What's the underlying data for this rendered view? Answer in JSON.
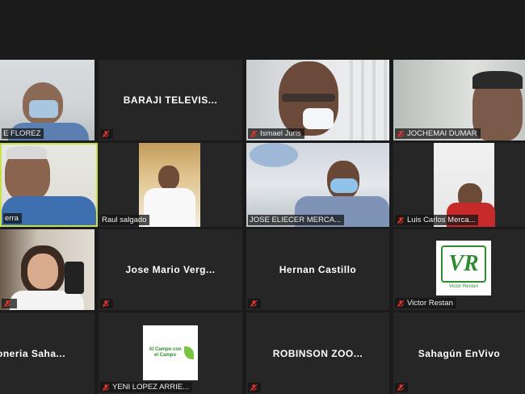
{
  "participants": [
    {
      "name": "E FLOREZ",
      "type": "video"
    },
    {
      "name": "BARAJI TELEVIS...",
      "type": "name"
    },
    {
      "name": "Ismael Juris",
      "type": "video"
    },
    {
      "name": "JOCHEMAI DUMAR",
      "type": "video"
    },
    {
      "name": "erra",
      "type": "video"
    },
    {
      "name": "Raul salgado",
      "type": "video"
    },
    {
      "name": "JOSE ELIECER MERCA...",
      "type": "video"
    },
    {
      "name": "Luis Carlos Merca...",
      "type": "video"
    },
    {
      "name": "",
      "type": "video"
    },
    {
      "name": "Jose Mario Verg...",
      "type": "name"
    },
    {
      "name": "Hernan Castillo",
      "type": "name"
    },
    {
      "name": "Victor Restan",
      "type": "avatar",
      "logo_text": "VR",
      "logo_sub": "Victor Restan"
    },
    {
      "name": "oneria Saha...",
      "type": "name"
    },
    {
      "name": "YENI LOPEZ ARRIE...",
      "type": "avatar",
      "logo_text": "Al Campo con el Campo"
    },
    {
      "name": "ROBINSON ZOO...",
      "type": "name"
    },
    {
      "name": "Sahagún EnVivo",
      "type": "name"
    }
  ],
  "colors": {
    "background": "#1b1b1b",
    "tile": "#262626",
    "active_border": "#c9e24a",
    "muted_mic": "#e0342c",
    "logo_green": "#2e8b2e"
  }
}
